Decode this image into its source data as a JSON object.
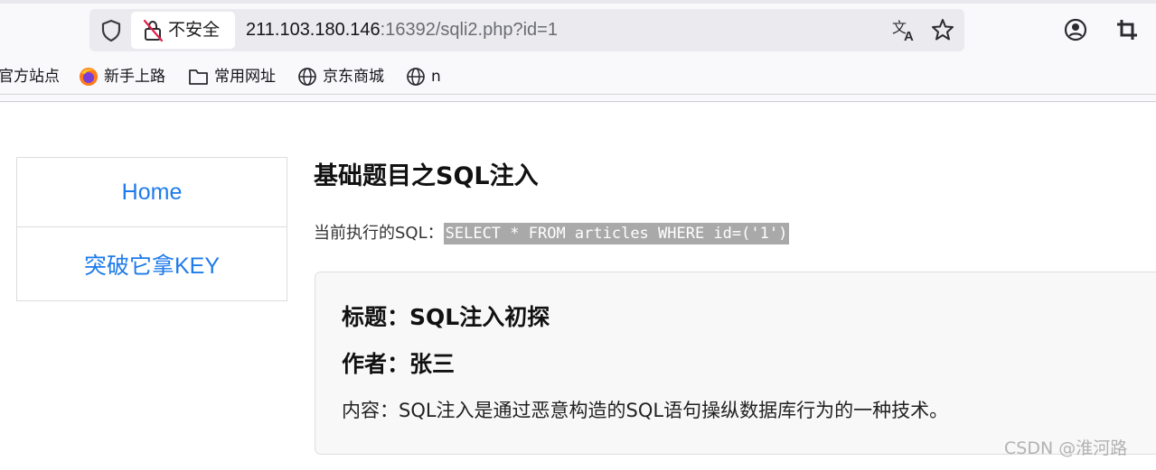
{
  "browser": {
    "security_label": "不安全",
    "url_host": "211.103.180.146",
    "url_rest": ":16392/sqli2.php?id=1",
    "bookmarks": [
      {
        "label": "官方站点",
        "icon": "none"
      },
      {
        "label": "新手上路",
        "icon": "firefox-icon"
      },
      {
        "label": "常用网址",
        "icon": "folder-icon"
      },
      {
        "label": "京东商城",
        "icon": "globe-icon"
      },
      {
        "label": "n",
        "icon": "globe-icon"
      }
    ]
  },
  "nav": {
    "items": [
      {
        "label": "Home"
      },
      {
        "label": "突破它拿KEY"
      }
    ],
    "link_color": "#1e7bea"
  },
  "main": {
    "title": "基础题目之SQL注入",
    "sql_label": "当前执行的SQL：",
    "sql_query": "SELECT * FROM articles WHERE id=('1')",
    "article": {
      "title": "标题：SQL注入初探",
      "author": "作者：张三",
      "content": "内容：SQL注入是通过恶意构造的SQL语句操纵数据库行为的一种技术。"
    }
  },
  "watermark": "CSDN @淮河路"
}
